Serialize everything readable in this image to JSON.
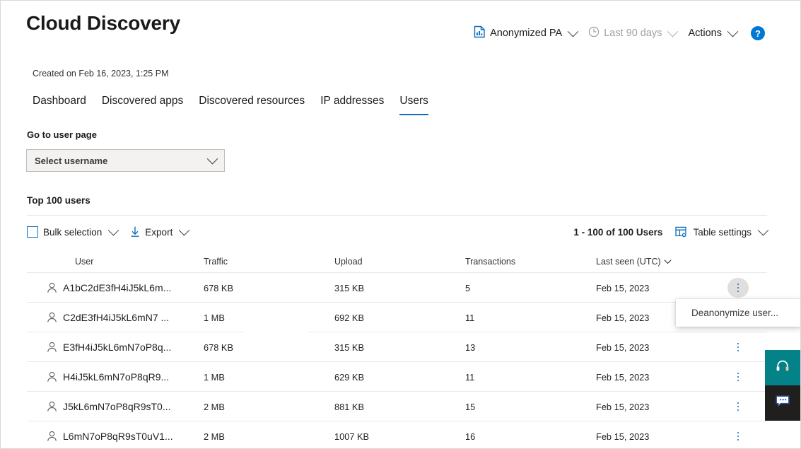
{
  "header": {
    "title": "Cloud Discovery",
    "created_on": "Created on Feb 16, 2023, 1:25 PM",
    "toolbar": {
      "report_icon": "report-chart-icon",
      "report_label": "Anonymized PA",
      "clock_icon": "clock-icon",
      "date_range_label": "Last 90 days",
      "actions_label": "Actions",
      "help_label": "?"
    }
  },
  "tabs": [
    {
      "label": "Dashboard",
      "active": false
    },
    {
      "label": "Discovered apps",
      "active": false
    },
    {
      "label": "Discovered resources",
      "active": false
    },
    {
      "label": "IP addresses",
      "active": false
    },
    {
      "label": "Users",
      "active": true
    }
  ],
  "user_page": {
    "label": "Go to user page",
    "select_value": "Select username",
    "select_placeholder": "Select username"
  },
  "table_section": {
    "title": "Top 100 users",
    "commands": {
      "bulk_selection": "Bulk selection",
      "export": "Export",
      "count": "1 - 100 of 100 Users",
      "table_settings": "Table settings"
    },
    "columns": [
      "User",
      "Traffic",
      "Upload",
      "Transactions",
      "Last seen (UTC)"
    ],
    "rows": [
      {
        "user": "A1bC2dE3fH4iJ5kL6m...",
        "traffic": "678 KB",
        "upload": "315 KB",
        "transactions": "5",
        "last_seen": "Feb 15, 2023"
      },
      {
        "user": "C2dE3fH4iJ5kL6mN7 ...",
        "traffic": "1 MB",
        "upload": "692 KB",
        "transactions": "11",
        "last_seen": "Feb 15, 2023"
      },
      {
        "user": "E3fH4iJ5kL6mN7oP8q...",
        "traffic": "678 KB",
        "upload": "315 KB",
        "transactions": "13",
        "last_seen": "Feb 15, 2023"
      },
      {
        "user": "H4iJ5kL6mN7oP8qR9...",
        "traffic": "1 MB",
        "upload": "629 KB",
        "transactions": "11",
        "last_seen": "Feb 15, 2023"
      },
      {
        "user": "J5kL6mN7oP8qR9sT0...",
        "traffic": "2 MB",
        "upload": "881 KB",
        "transactions": "15",
        "last_seen": "Feb 15, 2023"
      },
      {
        "user": "L6mN7oP8qR9sT0uV1...",
        "traffic": "2 MB",
        "upload": "1007 KB",
        "transactions": "16",
        "last_seen": "Feb 15, 2023"
      }
    ]
  },
  "context_menu": {
    "items": [
      {
        "label": "Deanonymize user..."
      }
    ]
  },
  "side_widgets": [
    {
      "name": "support-icon",
      "color": "#038387"
    },
    {
      "name": "feedback-icon",
      "color": "#201f1e"
    }
  ],
  "colors": {
    "accent": "#0078d4",
    "tab_underline": "#0f6cbd",
    "support_teal": "#038387",
    "feedback_dark": "#201f1e"
  }
}
